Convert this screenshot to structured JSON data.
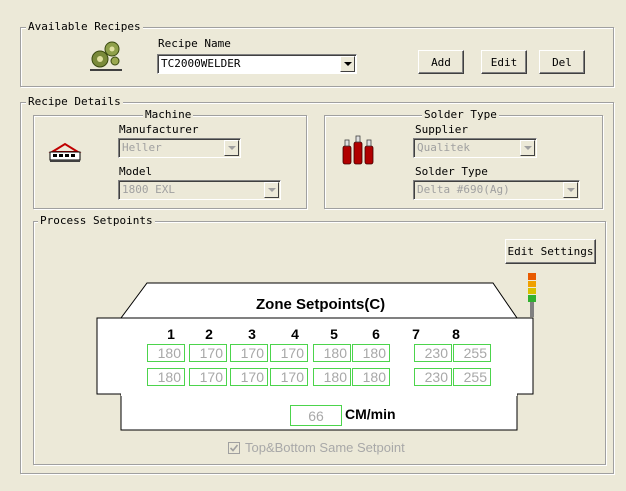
{
  "available_recipes": {
    "legend": "Available Recipes",
    "recipe_name_label": "Recipe Name",
    "recipe_name_value": "TC2000WELDER",
    "buttons": {
      "add": "Add",
      "edit": "Edit",
      "del": "Del"
    }
  },
  "recipe_details": {
    "legend": "Recipe Details",
    "machine": {
      "legend": "Machine",
      "manufacturer_label": "Manufacturer",
      "manufacturer_value": "Heller",
      "model_label": "Model",
      "model_value": "1800 EXL"
    },
    "solder": {
      "legend": "Solder Type",
      "supplier_label": "Supplier",
      "supplier_value": "Qualitek",
      "type_label": "Solder Type",
      "type_value": "Delta #690(Ag)"
    }
  },
  "process_setpoints": {
    "legend": "Process Setpoints",
    "edit_settings_label": "Edit Settings",
    "zone_title": "Zone Setpoints(C)",
    "zone_numbers": [
      "1",
      "2",
      "3",
      "4",
      "5",
      "6",
      "7",
      "8"
    ],
    "top_row": [
      "180",
      "170",
      "170",
      "170",
      "180",
      "180",
      "230",
      "255"
    ],
    "bottom_row": [
      "180",
      "170",
      "170",
      "170",
      "180",
      "180",
      "230",
      "255"
    ],
    "speed_value": "66",
    "speed_unit": "CM/min",
    "same_setpoint_label": "Top&Bottom Same Setpoint",
    "same_setpoint_checked": true
  },
  "colors": {
    "cell_border": "#4cd44c",
    "disabled_text": "#a8a8a8"
  }
}
